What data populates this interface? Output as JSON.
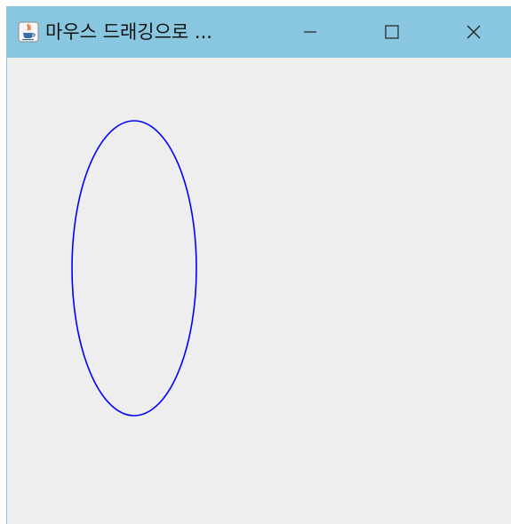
{
  "window": {
    "title": "마우스 드래깅으로 ...",
    "app_icon": "java-coffee-cup-icon",
    "controls": {
      "minimize_icon": "minimize-icon",
      "maximize_icon": "maximize-icon",
      "close_icon": "close-icon"
    },
    "titlebar_color": "#89c7e1",
    "background_color": "#eeeeee"
  },
  "canvas": {
    "shape": "oval",
    "stroke_color": "#0000ff"
  }
}
